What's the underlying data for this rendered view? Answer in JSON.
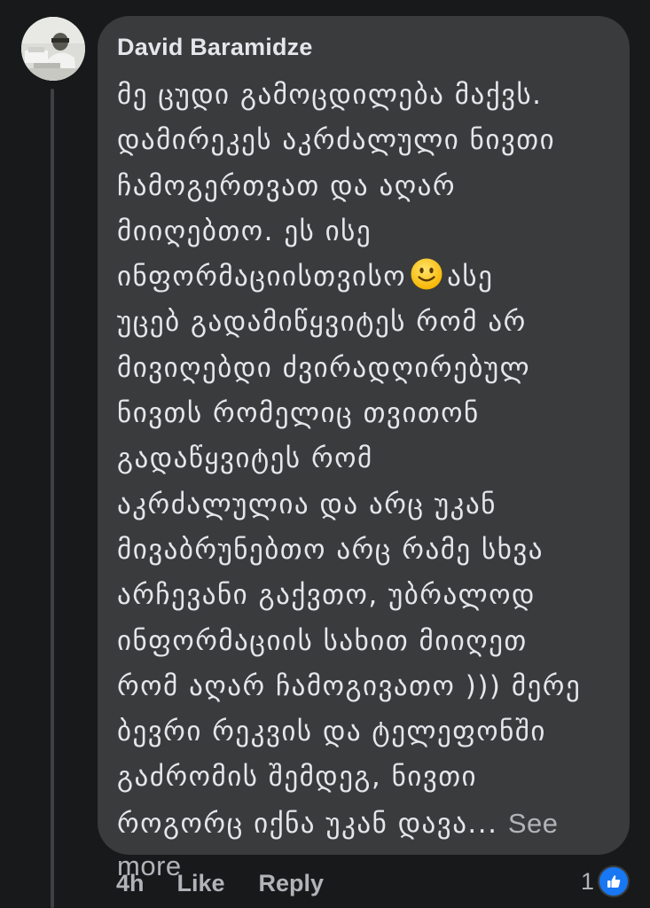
{
  "comment": {
    "author": "David Baramidze",
    "body_lines": [
      "მე ცუდი გამოცდილება მაქვს.",
      "დამირეკეს აკრძალული ნივთი",
      "ჩამოგერთვათ და აღარ",
      "მიიღებთო. ეს ისე",
      "ინფორმაციისთვისო",
      "უცებ გადამიწყვიტეს რომ არ",
      "მივიღებდი ძვირადღირებულ",
      "ნივთს რომელიც თვითონ",
      "გადაწყვიტეს რომ",
      "აკრძალულია და არც უკან",
      "მივაბრუნებთო არც რამე სხვა",
      "არჩევანი გაქვთო, უბრალოდ",
      "ინფორმაციის სახით მიიღეთ",
      "რომ აღარ ჩამოგივათო ))) მერე",
      "ბევრი რეკვის და ტელეფონში",
      "გაძრომის შემდეგ, ნივთი",
      "როგორც იქნა უკან დავა..."
    ],
    "line5_suffix": "ასე",
    "emoji_icon": "slightly-smiling-face-icon",
    "see_more_part1": "See",
    "see_more_part2": "more"
  },
  "actions": {
    "time": "4h",
    "like": "Like",
    "reply": "Reply"
  },
  "reactions": {
    "count": "1",
    "icon": "thumbs-up-icon",
    "badge_color": "#1877f2"
  },
  "colors": {
    "background": "#18191a",
    "bubble": "#3a3b3c",
    "text": "#e4e6eb",
    "muted": "#b0b3b8"
  }
}
